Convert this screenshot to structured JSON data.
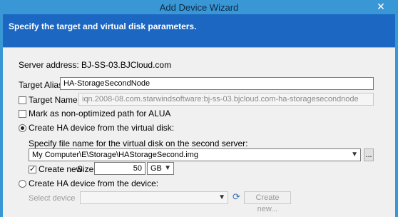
{
  "window": {
    "title": "Add Device Wizard",
    "close_symbol": "✕"
  },
  "header": {
    "text": "Specify the target and virtual disk parameters."
  },
  "form": {
    "server_address": "Server address: BJ-SS-03.BJCloud.com",
    "target_alias_label": "Target Alias:",
    "target_alias_value": "HA-StorageSecondNode",
    "target_name_label": "Target Name",
    "target_name_value": "iqn.2008-08.com.starwindsoftware:bj-ss-03.bjcloud.com-ha-storagesecondnode",
    "mark_non_optimized_label": "Mark as non-optimized path for ALUA",
    "create_from_virtual_disk_label": "Create HA device from the virtual disk:",
    "specify_file_label": "Specify file name for the virtual disk on the second server:",
    "file_path_value": "My Computer\\E\\Storage\\HAStorageSecond.img",
    "browse_label": "...",
    "create_new_label": "Create new",
    "size_label": "Size:",
    "size_value": "50",
    "size_unit": "GB",
    "create_from_device_label": "Create HA device from the device:",
    "select_device_label": "Select device",
    "create_new_button_label": "Create new..."
  },
  "state": {
    "target_name_checked": false,
    "mark_non_optimized_checked": false,
    "create_from_virtual_disk_selected": true,
    "create_new_checked": true,
    "create_from_device_selected": false
  },
  "colors": {
    "titlebar": "#3a97d6",
    "banner": "#1b67c2",
    "panel": "#f0f0f0"
  }
}
